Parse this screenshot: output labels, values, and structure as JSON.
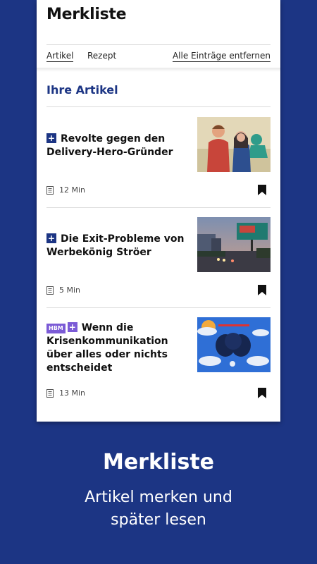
{
  "header": {
    "title": "Merkliste"
  },
  "tabs": {
    "articles": "Artikel",
    "recipes": "Rezept",
    "remove_all": "Alle Einträge entfernen"
  },
  "section": {
    "title": "Ihre Artikel"
  },
  "articles": [
    {
      "badge_hbm": "",
      "badge_plus": "+",
      "headline": "Revolte gegen den Delivery-Hero-Gründer",
      "read_time": "12 Min",
      "thumbnail": "two-people-portrait"
    },
    {
      "badge_hbm": "",
      "badge_plus": "+",
      "headline": "Die Exit-Probleme von Werbekönig Ströer",
      "read_time": "5 Min",
      "thumbnail": "street-billboard-at-dusk"
    },
    {
      "badge_hbm": "HBM",
      "badge_plus": "+",
      "headline": "Wenn die Krisenkommunikation über alles oder nichts entscheidet",
      "read_time": "13 Min",
      "thumbnail": "clouds-illustration"
    }
  ],
  "promo": {
    "title": "Merkliste",
    "subtitle_line1": "Artikel merken und",
    "subtitle_line2": "später lesen"
  },
  "colors": {
    "brand_blue": "#1c3584",
    "hbm_purple": "#7b5bd6",
    "background": "#1c3584"
  }
}
